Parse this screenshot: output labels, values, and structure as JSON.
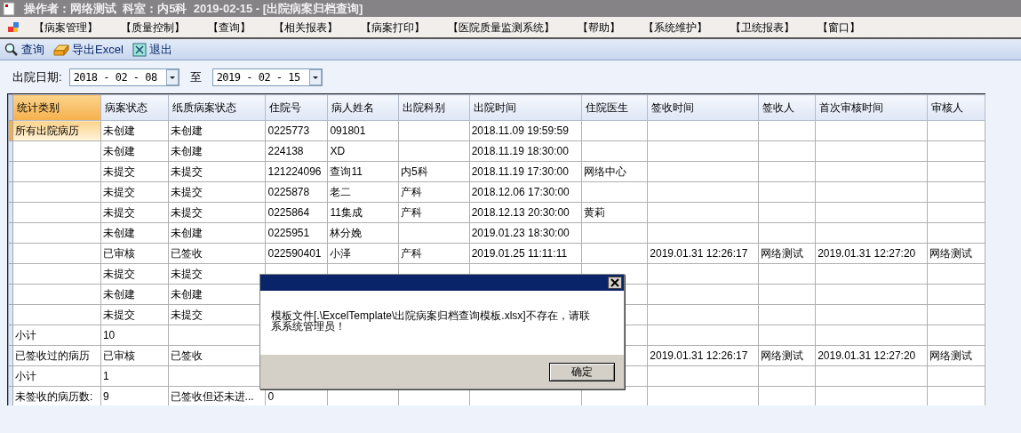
{
  "window": {
    "title": "操作者：网络测试  科室：内5科  2019-02-15 - [出院病案归档查询]"
  },
  "menu": [
    "【病案管理】",
    "【质量控制】",
    "【查询】",
    "【相关报表】",
    "【病案打印】",
    "【医院质量监测系统】",
    "【帮助】",
    "【系统维护】",
    "【卫统报表】",
    "【窗口】"
  ],
  "toolbar": [
    {
      "kind": "search",
      "label": "查询"
    },
    {
      "kind": "export",
      "label": "导出Excel"
    },
    {
      "kind": "exit",
      "label": "退出"
    }
  ],
  "filter": {
    "label": "出院日期:",
    "from": "2018 - 02 - 08",
    "separator": "至",
    "to": "2019 - 02 - 15"
  },
  "table": {
    "columns": [
      {
        "label": "统计类别",
        "selected": true
      },
      {
        "label": "病案状态",
        "selected": false
      },
      {
        "label": "纸质病案状态",
        "selected": false
      },
      {
        "label": "住院号",
        "selected": false
      },
      {
        "label": "病人姓名",
        "selected": false
      },
      {
        "label": "出院科别",
        "selected": false
      },
      {
        "label": "出院时间",
        "selected": false
      },
      {
        "label": "住院医生",
        "selected": false
      },
      {
        "label": "签收时间",
        "selected": false
      },
      {
        "label": "签收人",
        "selected": false
      },
      {
        "label": "首次审核时间",
        "selected": false
      },
      {
        "label": "审核人",
        "selected": false
      }
    ],
    "rows": [
      {
        "selected": true,
        "cells": [
          "所有出院病历",
          "未创建",
          "未创建",
          "0225773",
          "091801",
          "",
          "2018.11.09 19:59:59",
          "",
          "",
          "",
          "",
          ""
        ]
      },
      {
        "selected": false,
        "cells": [
          "",
          "未创建",
          "未创建",
          "224138",
          "XD",
          "",
          "2018.11.19 18:30:00",
          "",
          "",
          "",
          "",
          ""
        ]
      },
      {
        "selected": false,
        "cells": [
          "",
          "未提交",
          "未提交",
          "121224096",
          "查询11",
          "内5科",
          "2018.11.19 17:30:00",
          "网络中心",
          "",
          "",
          "",
          ""
        ]
      },
      {
        "selected": false,
        "cells": [
          "",
          "未提交",
          "未提交",
          "0225878",
          "老二",
          "产科",
          "2018.12.06 17:30:00",
          "",
          "",
          "",
          "",
          ""
        ]
      },
      {
        "selected": false,
        "cells": [
          "",
          "未提交",
          "未提交",
          "0225864",
          "11集成",
          "产科",
          "2018.12.13 20:30:00",
          "黄莉",
          "",
          "",
          "",
          ""
        ]
      },
      {
        "selected": false,
        "cells": [
          "",
          "未创建",
          "未创建",
          "0225951",
          "林分娩",
          "",
          "2019.01.23 18:30:00",
          "",
          "",
          "",
          "",
          ""
        ]
      },
      {
        "selected": false,
        "cells": [
          "",
          "已审核",
          "已签收",
          "022590401",
          "小泽",
          "产科",
          "2019.01.25 11:11:11",
          "",
          "2019.01.31 12:26:17",
          "网络测试",
          "2019.01.31 12:27:20",
          "网络测试"
        ]
      },
      {
        "selected": false,
        "cells": [
          "",
          "未提交",
          "未提交",
          "",
          "",
          "",
          "",
          "",
          "",
          "",
          "",
          ""
        ]
      },
      {
        "selected": false,
        "cells": [
          "",
          "未创建",
          "未创建",
          "",
          "",
          "",
          "",
          "",
          "",
          "",
          "",
          ""
        ]
      },
      {
        "selected": false,
        "cells": [
          "",
          "未提交",
          "未提交",
          "",
          "",
          "",
          "",
          "",
          "",
          "",
          "",
          ""
        ]
      },
      {
        "selected": false,
        "cells": [
          "小计",
          "10",
          "",
          "",
          "",
          "",
          "",
          "",
          "",
          "",
          "",
          ""
        ]
      },
      {
        "selected": false,
        "cells": [
          "已签收过的病历",
          "已审核",
          "已签收",
          "",
          "",
          "",
          "",
          "",
          "2019.01.31 12:26:17",
          "网络测试",
          "2019.01.31 12:27:20",
          "网络测试"
        ]
      },
      {
        "selected": false,
        "cells": [
          "小计",
          "1",
          "",
          "",
          "",
          "",
          "",
          "",
          "",
          "",
          "",
          ""
        ]
      },
      {
        "selected": false,
        "cells": [
          "未签收的病历数:",
          "9",
          "已签收但还未进...",
          "0",
          "",
          "",
          "",
          "",
          "",
          "",
          "",
          ""
        ]
      }
    ]
  },
  "dialog": {
    "message": "模板文件[.\\ExcelTemplate\\出院病案归档查询模板.xlsx]不存在，请联系系统管理员！",
    "ok": "确定"
  }
}
